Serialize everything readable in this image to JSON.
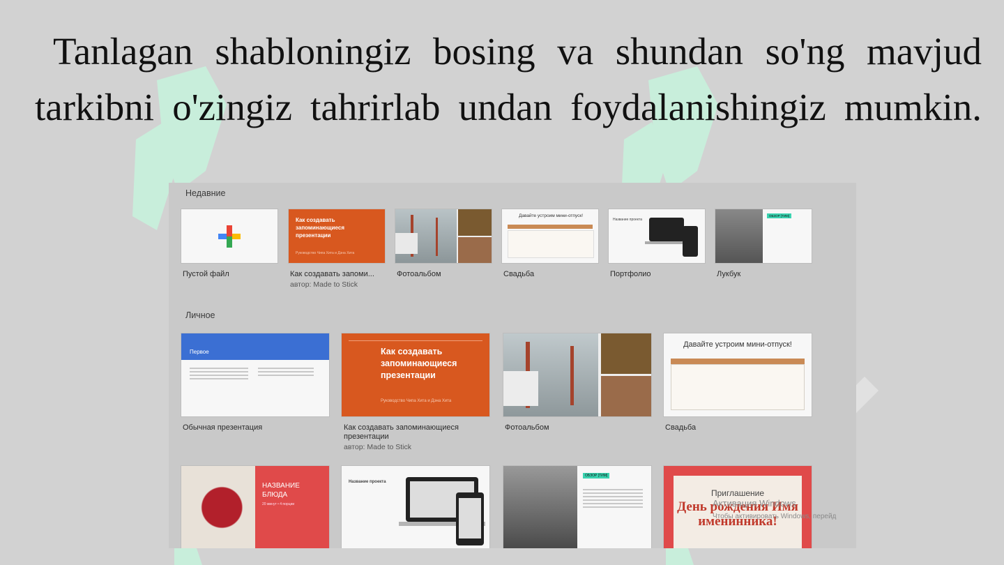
{
  "heading": {
    "line1": "Tanlagan shabloningiz bosing va shundan so'ng mavjud",
    "line2": "tarkibni o'zingiz tahrirlab undan foydalanishingiz mumkin."
  },
  "gallery": {
    "recent_label": "Недавние",
    "personal_label": "Личное",
    "recent": [
      {
        "name": "Пустой файл"
      },
      {
        "name": "Как создавать запоми...",
        "author": "автор: Made to Stick",
        "thumb_title": "Как создавать запоминающиеся презентации",
        "thumb_sub": "Руководство Чипа Хита и Дэна Хита"
      },
      {
        "name": "Фотоальбом"
      },
      {
        "name": "Свадьба",
        "thumb_title": "Давайте устроим мини-отпуск!"
      },
      {
        "name": "Портфолио",
        "thumb_title": "Название проекта"
      },
      {
        "name": "Лукбук",
        "thumb_tag": "ОБЗОР [ТИМ]"
      }
    ],
    "personal": [
      {
        "name": "Обычная презентация",
        "thumb_title": "Первое"
      },
      {
        "name": "Как создавать запоминающиеся презентации",
        "author": "автор: Made to Stick",
        "thumb_title": "Как создавать запоминающиеся презентации",
        "thumb_sub": "Руководство Чипа Хита и Дэна Хита"
      },
      {
        "name": "Фотоальбом"
      },
      {
        "name": "Свадьба",
        "thumb_title": "Давайте устроим мини-отпуск!"
      }
    ],
    "row3": [
      {
        "thumb_title": "НАЗВАНИЕ БЛЮДА",
        "thumb_sub": "20 минут • 4 порции"
      },
      {
        "thumb_title": "Название проекта"
      },
      {
        "thumb_tag": "ОБЗОР [ТИМ]"
      },
      {
        "thumb_title": "Приглашение",
        "thumb_big": "День рождения Имя именинника!"
      }
    ]
  },
  "os_overlay": {
    "title": "Активация Windows",
    "text": "Чтобы активировать Windows, перейд"
  },
  "colors": {
    "accent_orange": "#d8581f",
    "accent_blue": "#3b6fd3",
    "accent_red": "#e04a4a",
    "watermark": "#c6eedc"
  }
}
